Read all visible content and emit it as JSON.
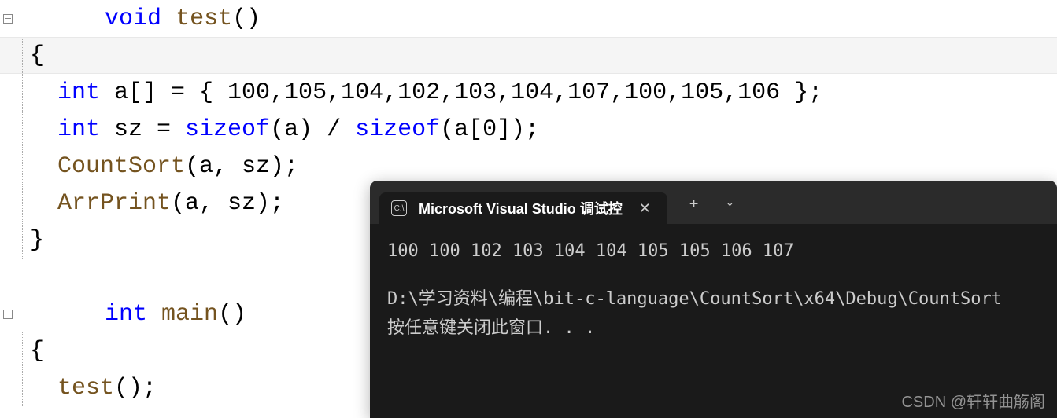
{
  "code": {
    "line1": {
      "void": "void",
      "test": "test",
      "parens": "()"
    },
    "line2": "{",
    "line3": {
      "int": "int",
      "var": " a[] = { ",
      "values": "100,105,104,102,103,104,107,100,105,106 };"
    },
    "line4": {
      "int": "int",
      "sz": " sz = ",
      "sizeof1": "sizeof",
      "p1": "(a) / ",
      "sizeof2": "sizeof",
      "p2": "(a[0]);"
    },
    "line5": {
      "fn": "CountSort",
      "args": "(a, sz);"
    },
    "line6": {
      "fn": "ArrPrint",
      "args": "(a, sz);"
    },
    "line7": "}",
    "line8": {
      "int": "int",
      "main": " main",
      "parens": "()"
    },
    "line9": "{",
    "line10": {
      "fn": "test",
      "args": "();"
    }
  },
  "console": {
    "tab_title": "Microsoft Visual Studio 调试控",
    "output_line1": "100 100 102 103 104 104 105 105 106 107",
    "output_line2": "D:\\学习资料\\编程\\bit-c-language\\CountSort\\x64\\Debug\\CountSort",
    "output_line3": "按任意键关闭此窗口. . ."
  },
  "watermark": "CSDN @轩轩曲觞阁"
}
